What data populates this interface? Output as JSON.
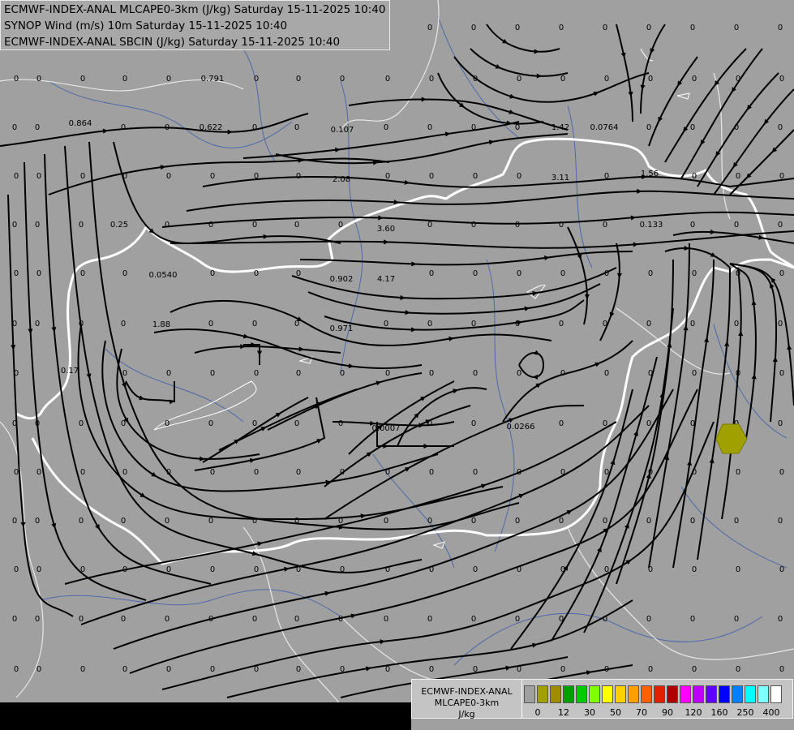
{
  "header": {
    "lines": [
      "ECMWF-INDEX-ANAL MLCAPE0-3km (J/kg) Saturday 15-11-2025 10:40",
      "SYNOP Wind (m/s) 10m Saturday 15-11-2025 10:40",
      "ECMWF-INDEX-ANAL SBCIN (J/kg) Saturday 15-11-2025 10:40"
    ]
  },
  "legend": {
    "line1": "ECMWF-INDEX-ANAL",
    "line2": "MLCAPE0-3km",
    "line3": "J/kg",
    "colors": [
      "#a0a0a0",
      "#a0a000",
      "#a08c00",
      "#00a000",
      "#00cc00",
      "#80ff00",
      "#ffff00",
      "#ffd000",
      "#ffa000",
      "#ff6000",
      "#e02000",
      "#b00000",
      "#ff00ff",
      "#c000ff",
      "#6000ff",
      "#0000ff",
      "#0080ff",
      "#00ffff",
      "#80ffff",
      "#ffffff"
    ],
    "ticks": [
      "0",
      "12",
      "30",
      "50",
      "70",
      "90",
      "120",
      "160",
      "250",
      "400"
    ]
  },
  "map": {
    "labels": [
      {
        "t": "0",
        "col": "a"
      },
      {
        "t": "0",
        "col": "a"
      },
      {
        "t": "0",
        "col": "a"
      },
      {
        "t": "0",
        "col": "a"
      },
      {
        "t": "0",
        "col": "a"
      },
      {
        "t": "0.791"
      },
      {
        "t": "0.864"
      },
      {
        "t": "0.622"
      },
      {
        "t": "0.107"
      },
      {
        "t": "1.42"
      },
      {
        "t": "0.0764"
      },
      {
        "t": "2.08"
      },
      {
        "t": "3.11"
      },
      {
        "t": "1.56"
      },
      {
        "t": "0.25"
      },
      {
        "t": "3.60"
      },
      {
        "t": "0.133"
      },
      {
        "t": "0.0540"
      },
      {
        "t": "0.902"
      },
      {
        "t": "4.17"
      },
      {
        "t": "1.88"
      },
      {
        "t": "0.971"
      },
      {
        "t": "0.17"
      },
      {
        "t": "0.0007"
      },
      {
        "t": "0.0266"
      }
    ]
  }
}
